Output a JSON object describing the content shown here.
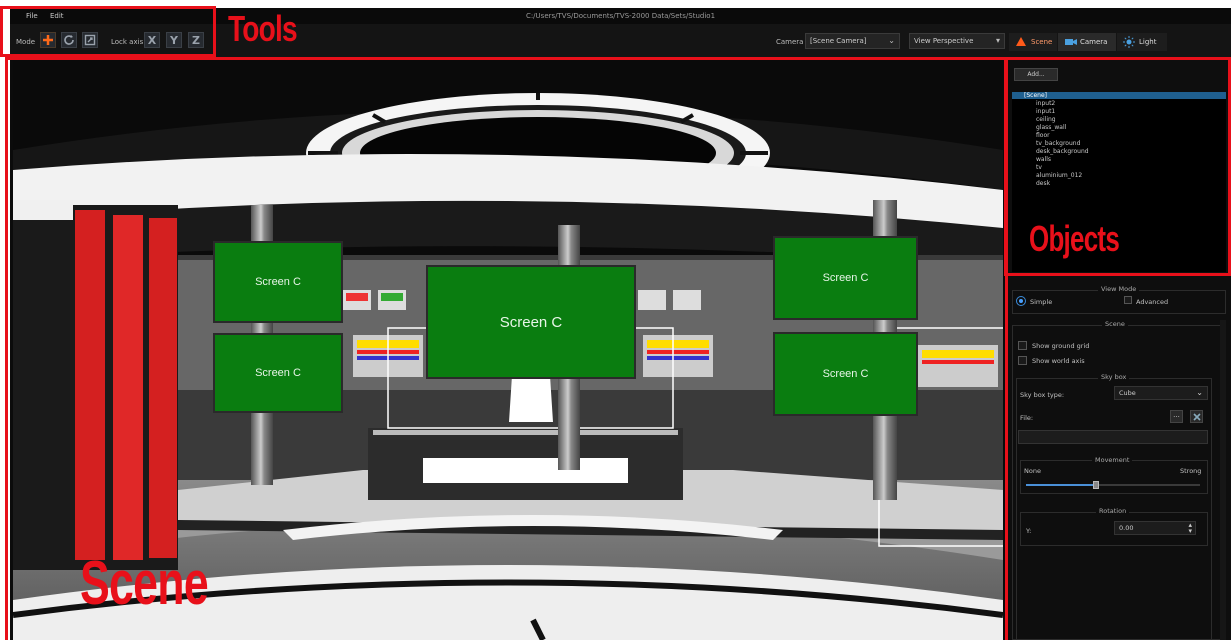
{
  "menu": {
    "file": "File",
    "edit": "Edit"
  },
  "window_title": "C:/Users/TVS/Documents/TVS-2000 Data/Sets/Studio1",
  "toolbar": {
    "mode_label": "Mode",
    "lock_axis_label": "Lock axis",
    "axes": [
      "X",
      "Y",
      "Z"
    ],
    "camera_label": "Camera",
    "camera_value": "[Scene Camera]",
    "view_value": "View Perspective",
    "tabs": {
      "scene": "Scene",
      "camera": "Camera",
      "light": "Light"
    }
  },
  "scene": {
    "screens": [
      "Screen C",
      "Screen C",
      "Screen C",
      "Screen C",
      "Screen C"
    ]
  },
  "objects": {
    "add_label": "Add...",
    "root": "[Scene]",
    "items": [
      "input2",
      "input1",
      "ceiling",
      "glass_wall",
      "floor",
      "tv_background",
      "desk_background",
      "walls",
      "tv",
      "aluminium_012",
      "desk"
    ]
  },
  "properties": {
    "view_mode_title": "View Mode",
    "simple": "Simple",
    "advanced": "Advanced",
    "scene_title": "Scene",
    "show_ground_grid": "Show ground grid",
    "show_world_axis": "Show world axis",
    "skybox_title": "Sky box",
    "skybox_type_label": "Sky box type:",
    "skybox_type_value": "Cube",
    "file_label": "File:",
    "file_browse": "...",
    "movement_title": "Movement",
    "movement_min": "None",
    "movement_max": "Strong",
    "movement_level": 0.4,
    "rotation_title": "Rotation",
    "rotation_y_label": "Y:",
    "rotation_y_value": "0.00"
  },
  "annotations": {
    "tools": "Tools",
    "objects": "Objects",
    "scene": "Scene"
  },
  "colors": {
    "annotation": "#e8101a",
    "screen_green": "#0a7d10",
    "selection": "#1f5f8f"
  }
}
